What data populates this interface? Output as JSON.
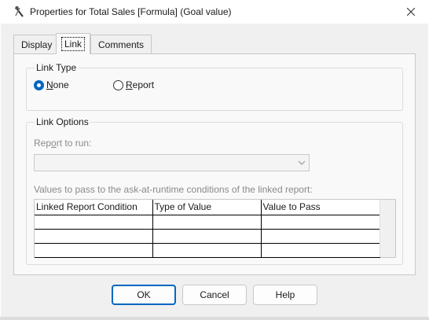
{
  "window": {
    "title": "Properties for Total Sales [Formula] (Goal value)",
    "app_icon": "properties-tools-icon",
    "close_icon": "close-icon"
  },
  "tabs": [
    {
      "label": "Display",
      "active": false
    },
    {
      "label": "Link",
      "active": true
    },
    {
      "label": "Comments",
      "active": false
    }
  ],
  "link_type": {
    "legend": "Link Type",
    "options": [
      {
        "label_underlined": "N",
        "label_rest": "one",
        "checked": true
      },
      {
        "label_underlined": "R",
        "label_rest": "eport",
        "checked": false
      }
    ]
  },
  "link_options": {
    "legend": "Link Options",
    "report_label_pre": "Rep",
    "report_label_u": "o",
    "report_label_post": "rt to run:",
    "report_value": "",
    "values_label": "Values to pass to the ask-at-runtime conditions of the linked report:",
    "columns": [
      "Linked Report Condition",
      "Type of Value",
      "Value to Pass"
    ],
    "rows": [
      [
        "",
        "",
        ""
      ],
      [
        "",
        "",
        ""
      ],
      [
        "",
        "",
        ""
      ]
    ]
  },
  "buttons": {
    "ok": "OK",
    "cancel": "Cancel",
    "help": "Help"
  },
  "colors": {
    "accent": "#0067c0",
    "dialog_bg": "#f0f0f0",
    "panel_bg": "#f9f9f9",
    "disabled_text": "#8a8a8a"
  }
}
